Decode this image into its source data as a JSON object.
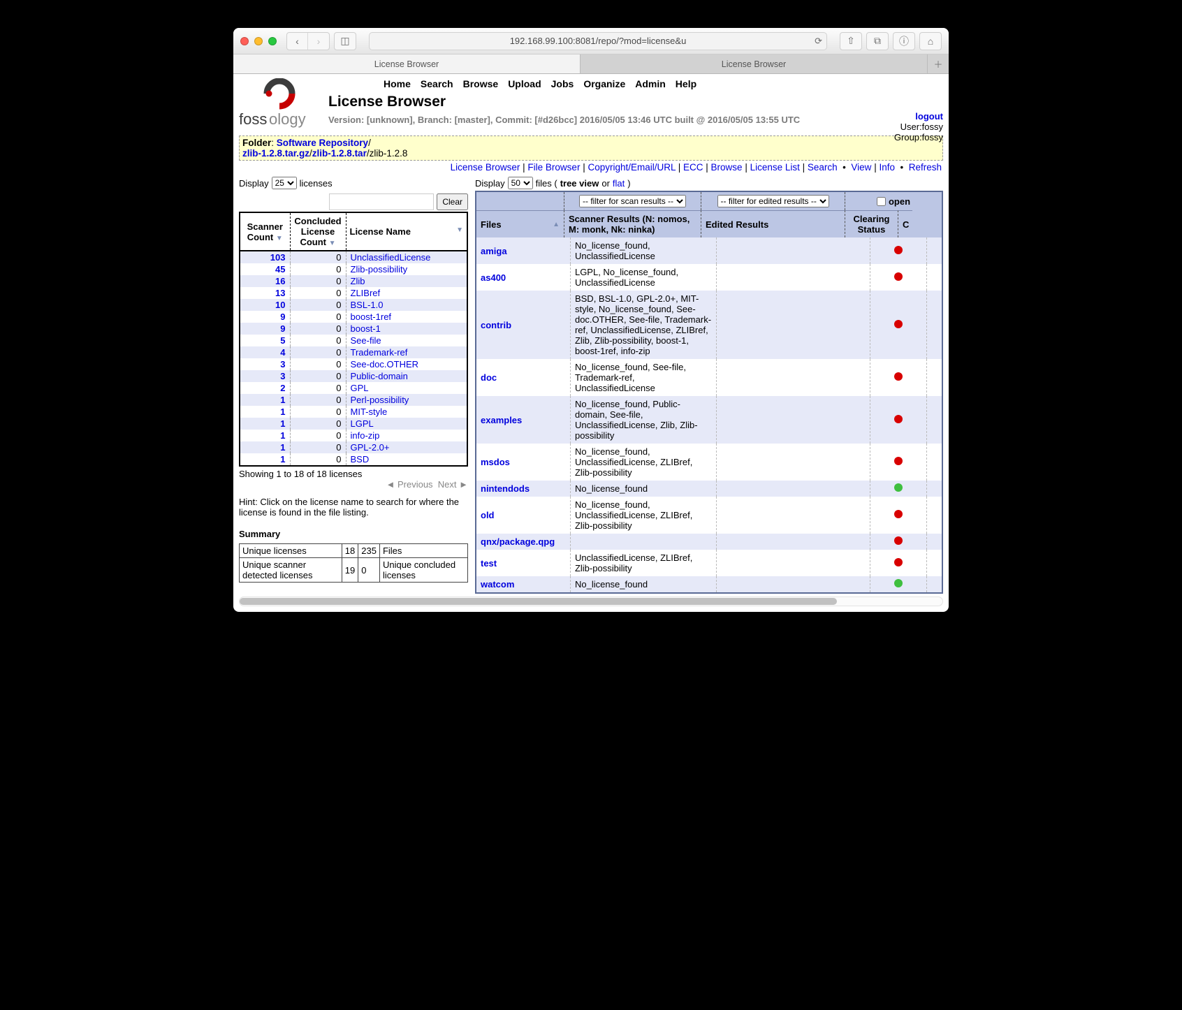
{
  "browser": {
    "url": "192.168.99.100:8081/repo/?mod=license&u",
    "tabs": [
      "License Browser",
      "License Browser"
    ]
  },
  "menu": [
    "Home",
    "Search",
    "Browse",
    "Upload",
    "Jobs",
    "Organize",
    "Admin",
    "Help"
  ],
  "logo_text": "fossology",
  "page_title": "License Browser",
  "version_line": "Version: [unknown], Branch: [master], Commit: [#d26bcc] 2016/05/05 13:46 UTC built @ 2016/05/05 13:55 UTC",
  "user": {
    "logout": "logout",
    "user": "User:fossy",
    "group": "Group:fossy"
  },
  "folder": {
    "label": "Folder",
    "parts": [
      "Software Repository",
      "zlib-1.2.8.tar.gz",
      "zlib-1.2.8.tar",
      "zlib-1.2.8"
    ],
    "final_is_link": false
  },
  "subnav": {
    "items": [
      "License Browser",
      "File Browser",
      "Copyright/Email/URL",
      "ECC",
      "Browse",
      "License List",
      "Search"
    ],
    "right": [
      "View",
      "Info",
      "Refresh"
    ]
  },
  "left": {
    "display_label": "Display",
    "display_value": "25",
    "display_suffix": "licenses",
    "search_placeholder": "",
    "clear_label": "Clear",
    "columns": [
      "Scanner Count",
      "Concluded License Count",
      "License Name"
    ],
    "rows": [
      {
        "s": 103,
        "c": 0,
        "n": "UnclassifiedLicense"
      },
      {
        "s": 45,
        "c": 0,
        "n": "Zlib-possibility"
      },
      {
        "s": 16,
        "c": 0,
        "n": "Zlib"
      },
      {
        "s": 13,
        "c": 0,
        "n": "ZLIBref"
      },
      {
        "s": 10,
        "c": 0,
        "n": "BSL-1.0"
      },
      {
        "s": 9,
        "c": 0,
        "n": "boost-1ref"
      },
      {
        "s": 9,
        "c": 0,
        "n": "boost-1"
      },
      {
        "s": 5,
        "c": 0,
        "n": "See-file"
      },
      {
        "s": 4,
        "c": 0,
        "n": "Trademark-ref"
      },
      {
        "s": 3,
        "c": 0,
        "n": "See-doc.OTHER"
      },
      {
        "s": 3,
        "c": 0,
        "n": "Public-domain"
      },
      {
        "s": 2,
        "c": 0,
        "n": "GPL"
      },
      {
        "s": 1,
        "c": 0,
        "n": "Perl-possibility"
      },
      {
        "s": 1,
        "c": 0,
        "n": "MIT-style"
      },
      {
        "s": 1,
        "c": 0,
        "n": "LGPL"
      },
      {
        "s": 1,
        "c": 0,
        "n": "info-zip"
      },
      {
        "s": 1,
        "c": 0,
        "n": "GPL-2.0+"
      },
      {
        "s": 1,
        "c": 0,
        "n": "BSD"
      }
    ],
    "showing": "Showing 1 to 18 of 18 licenses",
    "prev": "Previous",
    "next": "Next",
    "hint": "Hint: Click on the license name to search for where the license is found in the file listing.",
    "summary_label": "Summary",
    "summary": {
      "r1c1": "Unique licenses",
      "r1c2": "18",
      "r1c3": "235",
      "r1c4": "Files",
      "r2c1": "Unique scanner detected licenses",
      "r2c2": "19",
      "r2c3": "0",
      "r2c4": "Unique concluded licenses"
    }
  },
  "right": {
    "display_label": "Display",
    "display_value": "50",
    "suffix_before": "files (",
    "tree": "tree view",
    "or": " or ",
    "flat": "flat",
    "suffix_after": ")",
    "filter_scan": "-- filter for scan results --",
    "filter_edited": "-- filter for edited results --",
    "open": "open",
    "columns": {
      "files": "Files",
      "scanner": "Scanner Results (N: nomos, M: monk, Nk: ninka)",
      "edited": "Edited Results",
      "clearing": "Clearing Status",
      "last": "C"
    },
    "rows": [
      {
        "f": "amiga",
        "sr": "No_license_found, UnclassifiedLicense",
        "dot": "red"
      },
      {
        "f": "as400",
        "sr": "LGPL, No_license_found, UnclassifiedLicense",
        "dot": "red"
      },
      {
        "f": "contrib",
        "sr": "BSD, BSL-1.0, GPL-2.0+, MIT-style, No_license_found, See-doc.OTHER, See-file, Trademark-ref, UnclassifiedLicense, ZLIBref, Zlib, Zlib-possibility, boost-1, boost-1ref, info-zip",
        "dot": "red"
      },
      {
        "f": "doc",
        "sr": "No_license_found, See-file, Trademark-ref, UnclassifiedLicense",
        "dot": "red"
      },
      {
        "f": "examples",
        "sr": "No_license_found, Public-domain, See-file, UnclassifiedLicense, Zlib, Zlib-possibility",
        "dot": "red"
      },
      {
        "f": "msdos",
        "sr": "No_license_found, UnclassifiedLicense, ZLIBref, Zlib-possibility",
        "dot": "red"
      },
      {
        "f": "nintendods",
        "sr": "No_license_found",
        "dot": "green"
      },
      {
        "f": "old",
        "sr": "No_license_found, UnclassifiedLicense, ZLIBref, Zlib-possibility",
        "dot": "red"
      },
      {
        "f": "qnx/package.qpg",
        "sr": "",
        "dot": "red"
      },
      {
        "f": "test",
        "sr": "UnclassifiedLicense, ZLIBref, Zlib-possibility",
        "dot": "red"
      },
      {
        "f": "watcom",
        "sr": "No_license_found",
        "dot": "green"
      }
    ]
  }
}
